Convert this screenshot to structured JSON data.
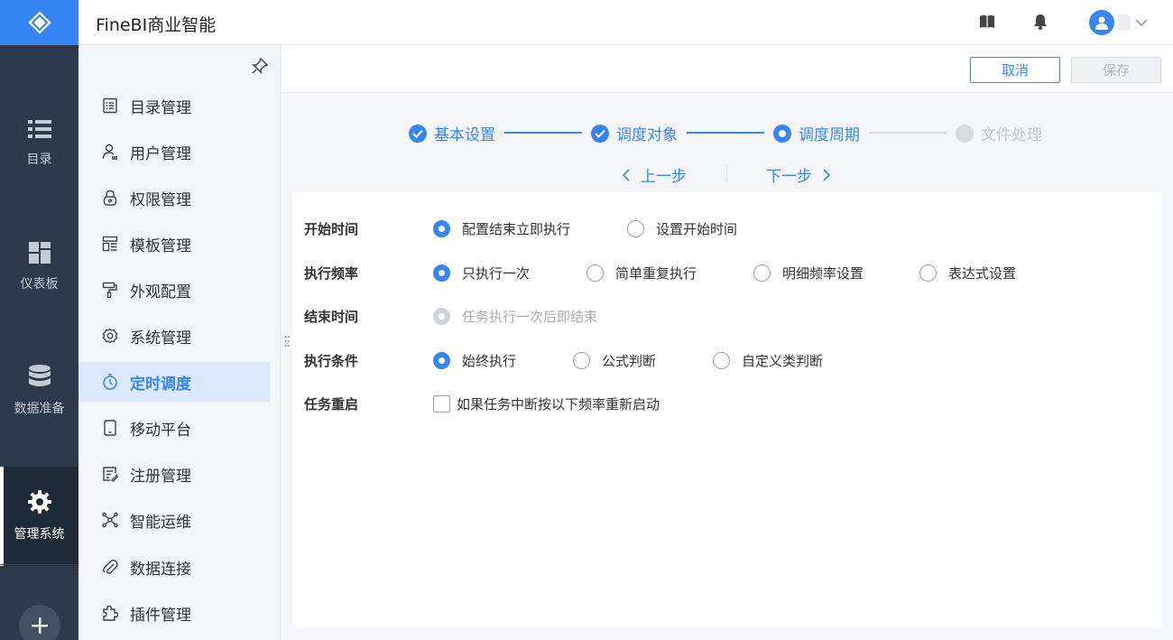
{
  "app": {
    "title": "FineBI商业智能"
  },
  "colors": {
    "accent": "#3685f2",
    "rail_bg": "#2d3a4b",
    "active_nav_bg": "#dce8fb"
  },
  "rail": {
    "items": [
      {
        "label": "目录",
        "icon": "list-icon"
      },
      {
        "label": "仪表板",
        "icon": "dashboard-icon"
      },
      {
        "label": "数据准备",
        "icon": "database-icon"
      },
      {
        "label": "管理系统",
        "icon": "gear-icon",
        "active": true
      }
    ]
  },
  "sidebar": {
    "items": [
      {
        "label": "目录管理",
        "icon": "catalog-icon"
      },
      {
        "label": "用户管理",
        "icon": "user-icon"
      },
      {
        "label": "权限管理",
        "icon": "lock-icon"
      },
      {
        "label": "模板管理",
        "icon": "template-icon"
      },
      {
        "label": "外观配置",
        "icon": "paint-roller-icon"
      },
      {
        "label": "系统管理",
        "icon": "gear-icon"
      },
      {
        "label": "定时调度",
        "icon": "timer-icon",
        "active": true
      },
      {
        "label": "移动平台",
        "icon": "tablet-icon"
      },
      {
        "label": "注册管理",
        "icon": "register-icon"
      },
      {
        "label": "智能运维",
        "icon": "network-icon"
      },
      {
        "label": "数据连接",
        "icon": "paperclip-icon"
      },
      {
        "label": "插件管理",
        "icon": "puzzle-icon"
      }
    ]
  },
  "toolbar": {
    "cancel_label": "取消",
    "save_label": "保存"
  },
  "steps": [
    {
      "label": "基本设置",
      "state": "done"
    },
    {
      "label": "调度对象",
      "state": "done"
    },
    {
      "label": "调度周期",
      "state": "current"
    },
    {
      "label": "文件处理",
      "state": "todo"
    }
  ],
  "stepnav": {
    "prev_label": "上一步",
    "next_label": "下一步"
  },
  "form": {
    "start_time": {
      "label": "开始时间",
      "options": [
        "配置结束立即执行",
        "设置开始时间"
      ],
      "selected": 0
    },
    "frequency": {
      "label": "执行频率",
      "options": [
        "只执行一次",
        "简单重复执行",
        "明细频率设置",
        "表达式设置"
      ],
      "selected": 0
    },
    "end_time": {
      "label": "结束时间",
      "options": [
        "任务执行一次后即结束"
      ],
      "selected": 0,
      "disabled": true
    },
    "condition": {
      "label": "执行条件",
      "options": [
        "始终执行",
        "公式判断",
        "自定义类判断"
      ],
      "selected": 0
    },
    "restart": {
      "label": "任务重启",
      "checkbox_label": "如果任务中断按以下频率重新启动",
      "checked": false
    }
  }
}
